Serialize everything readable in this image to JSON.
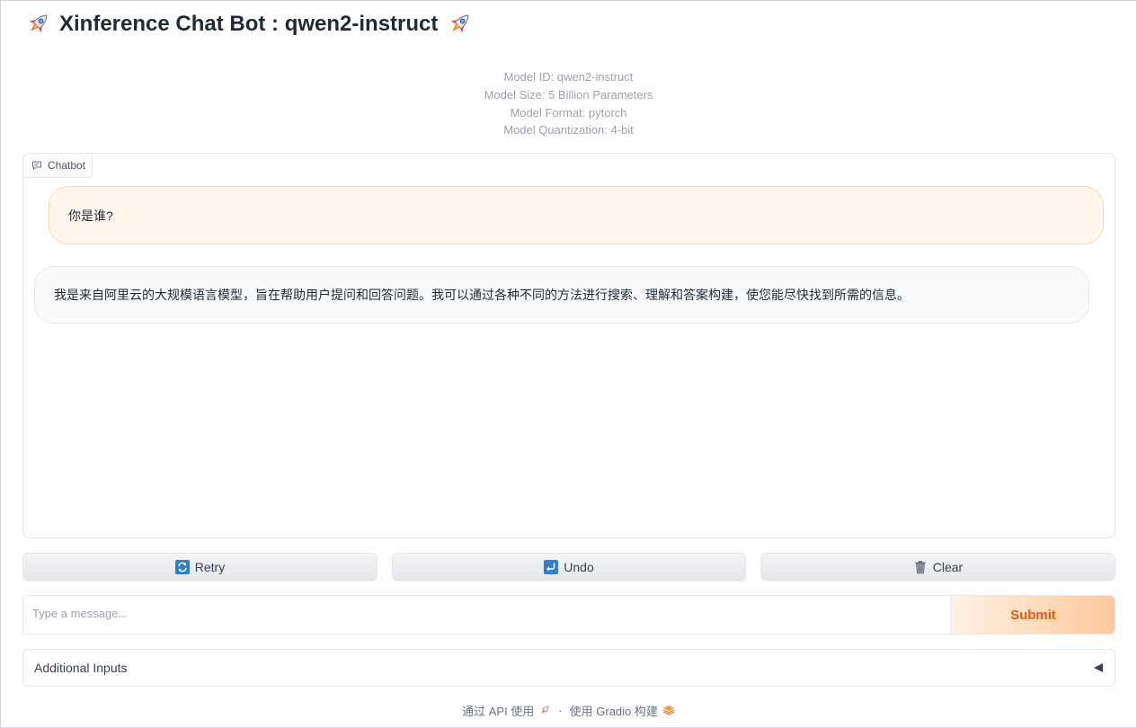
{
  "header": {
    "title": "Xinference Chat Bot : qwen2-instruct"
  },
  "model_info": {
    "lines": [
      "Model ID: qwen2-instruct",
      "Model Size: 5 Billion Parameters",
      "Model Format: pytorch",
      "Model Quantization: 4-bit"
    ]
  },
  "chatbot": {
    "label": "Chatbot",
    "messages": [
      {
        "role": "user",
        "text": "你是谁?"
      },
      {
        "role": "assistant",
        "text": "我是来自阿里云的大规模语言模型，旨在帮助用户提问和回答问题。我可以通过各种不同的方法进行搜索、理解和答案构建，使您能尽快找到所需的信息。"
      }
    ]
  },
  "actions": {
    "retry_label": "Retry",
    "undo_label": "Undo",
    "clear_label": "Clear"
  },
  "input": {
    "placeholder": "Type a message...",
    "value": "",
    "submit_label": "Submit"
  },
  "accordion": {
    "label": "Additional Inputs"
  },
  "footer": {
    "api_label": "通过 API 使用",
    "separator": "·",
    "gradio_label": "使用 Gradio 构建"
  },
  "colors": {
    "accent": "#ea580c",
    "user_bubble": "#fff7ed",
    "bot_bubble": "#f9fafb"
  }
}
